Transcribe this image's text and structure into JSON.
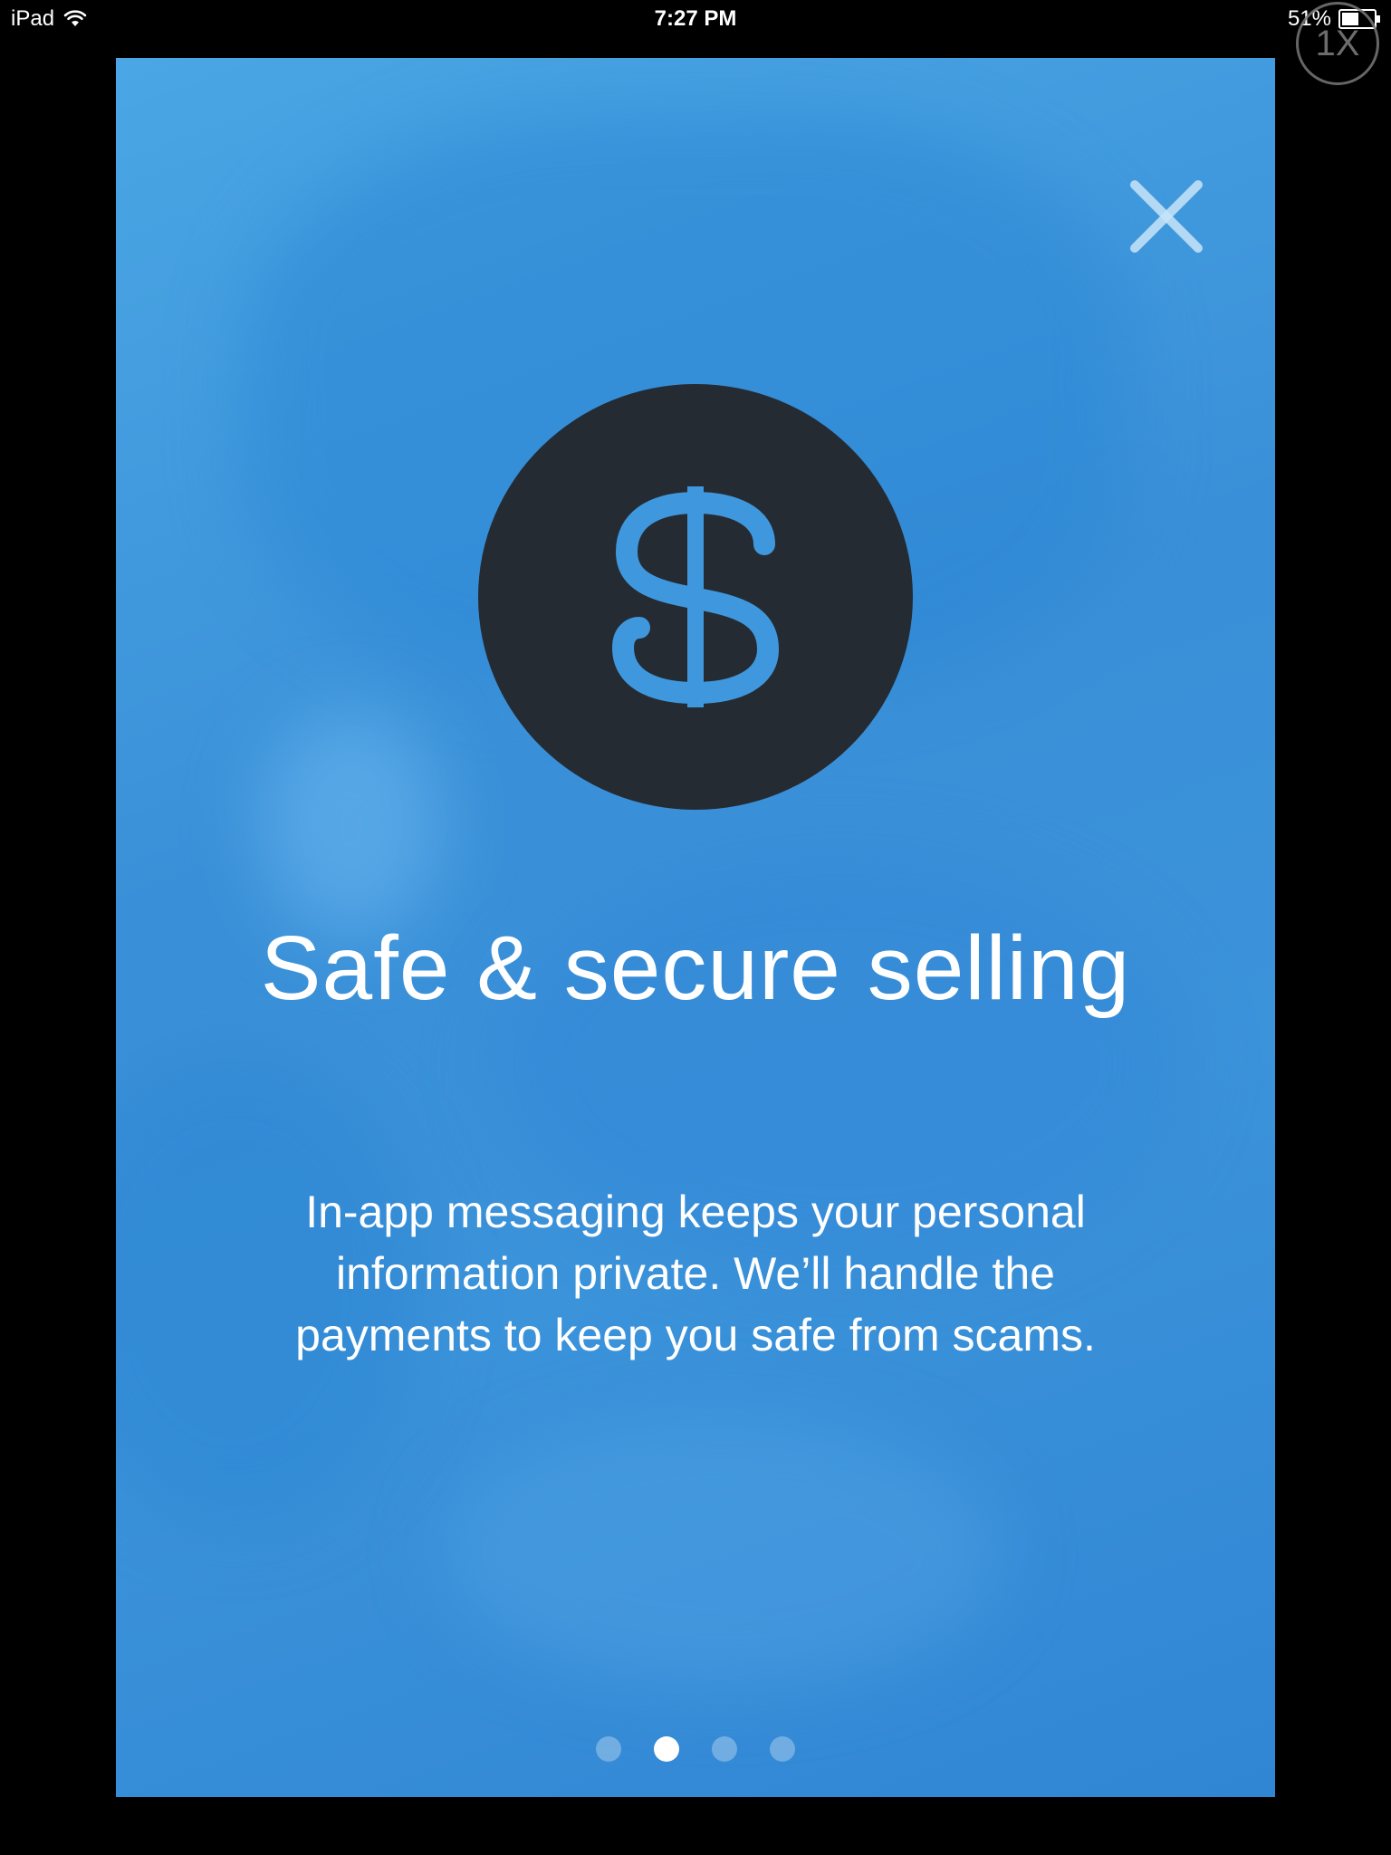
{
  "status_bar": {
    "device": "iPad",
    "time": "7:27 PM",
    "battery": "51%"
  },
  "overlay": {
    "speed_badge": "1X"
  },
  "onboarding": {
    "title": "Safe & secure selling",
    "description": "In-app messaging keeps your personal information private. We’ll handle the payments to keep you safe from scams.",
    "icon": "dollar-icon",
    "page_count": 4,
    "current_page": 2,
    "colors": {
      "background": "#3b93da",
      "icon_circle": "#252b33",
      "icon_accent": "#3f98dd",
      "text": "#ffffff"
    }
  }
}
